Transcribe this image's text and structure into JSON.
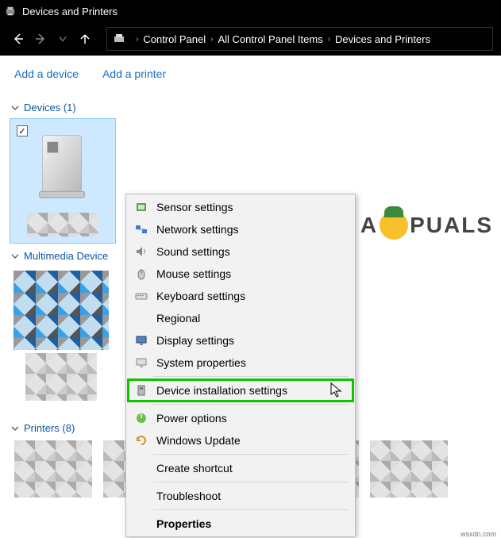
{
  "window": {
    "title": "Devices and Printers"
  },
  "breadcrumb": {
    "seg1": "Control Panel",
    "seg2": "All Control Panel Items",
    "seg3": "Devices and Printers"
  },
  "commands": {
    "add_device": "Add a device",
    "add_printer": "Add a printer"
  },
  "sections": {
    "devices": "Devices (1)",
    "multimedia": "Multimedia Device",
    "printers": "Printers (8)"
  },
  "context_menu": {
    "sensor": "Sensor settings",
    "network": "Network settings",
    "sound": "Sound settings",
    "mouse": "Mouse settings",
    "keyboard": "Keyboard settings",
    "regional": "Regional",
    "display": "Display settings",
    "system": "System properties",
    "device_install": "Device installation settings",
    "power": "Power options",
    "update": "Windows Update",
    "shortcut": "Create shortcut",
    "troubleshoot": "Troubleshoot",
    "properties": "Properties"
  },
  "watermark": {
    "pre": "A",
    "post": "PUALS"
  },
  "footer": "wsxdn.com"
}
